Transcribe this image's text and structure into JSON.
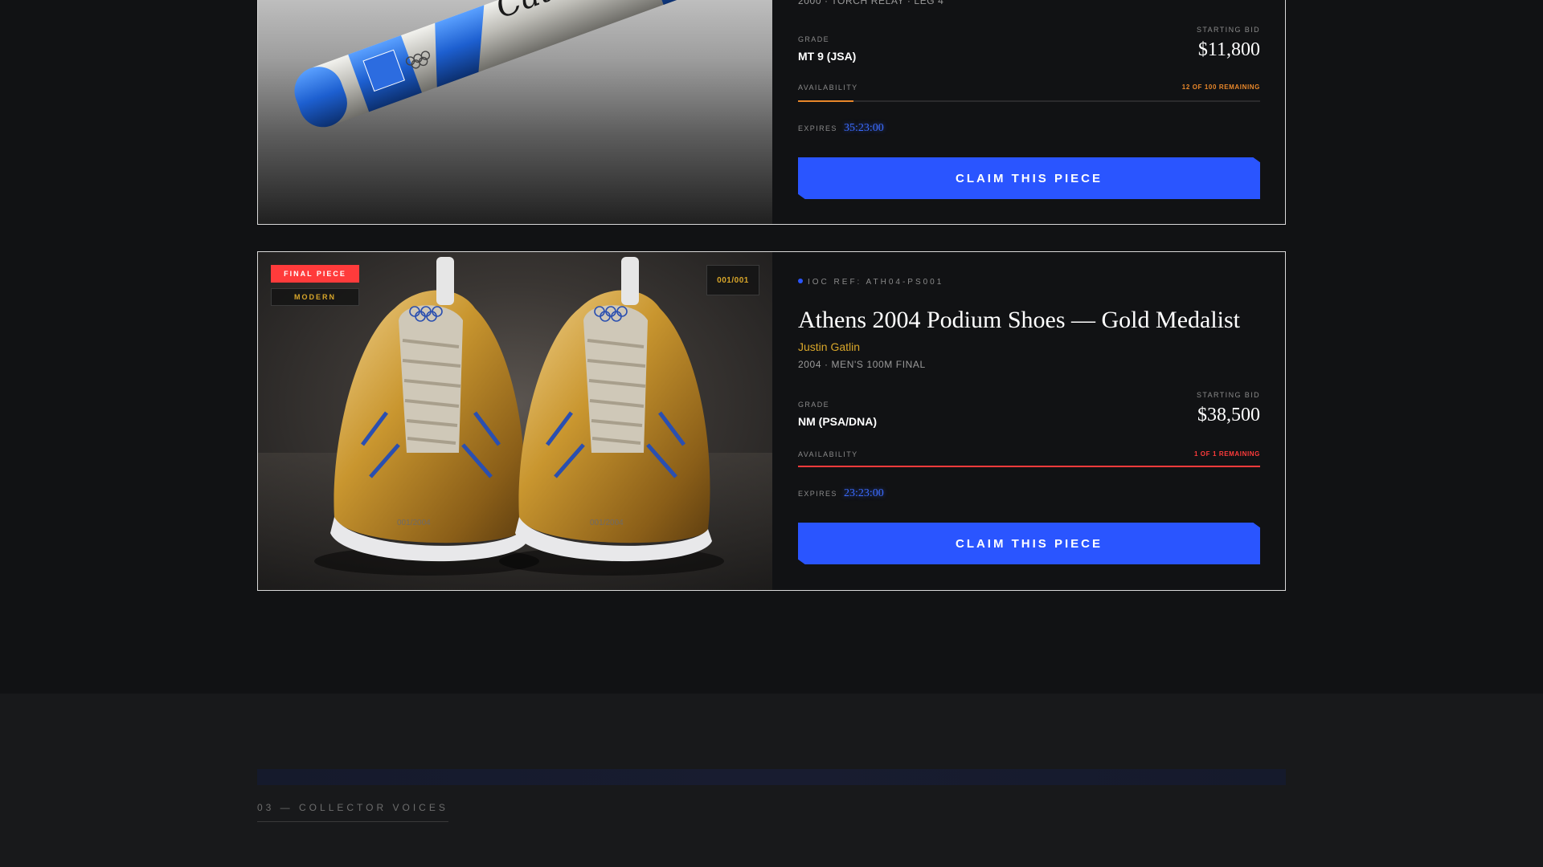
{
  "colors": {
    "accent": "#2a55ff",
    "gold": "#d8a62a",
    "warning_orange": "#e8872a",
    "danger_red": "#ff3b3b",
    "background": "#111214"
  },
  "listings": [
    {
      "subline_partial": "2000 · TORCH RELAY · LEG 4",
      "image_icon": "relay-baton-image",
      "image_signature": "Cathy Freeman",
      "grade_label": "GRADE",
      "grade_value": "MT 9 (JSA)",
      "bid_label": "STARTING BID",
      "bid_value": "$11,800",
      "availability_label": "AVAILABILITY",
      "remaining_text": "12 OF 100 REMAINING",
      "remaining_fraction": 0.12,
      "remaining_color": "#e8872a",
      "expires_label": "EXPIRES",
      "expires_value": "35:23:00",
      "claim_label": "CLAIM THIS PIECE"
    },
    {
      "badges": [
        "FINAL PIECE",
        "MODERN"
      ],
      "edition": "001/001",
      "ioc_ref": "IOC REF: ATH04-PS001",
      "title": "Athens 2004 Podium Shoes — Gold Medalist",
      "athlete": "Justin Gatlin",
      "subline": "2004 · MEN'S 100M FINAL",
      "image_icon": "gold-running-shoes-image",
      "shoe_serial": "001/2004",
      "grade_label": "GRADE",
      "grade_value": "NM (PSA/DNA)",
      "bid_label": "STARTING BID",
      "bid_value": "$38,500",
      "availability_label": "AVAILABILITY",
      "remaining_text": "1 OF 1 REMAINING",
      "remaining_fraction": 1.0,
      "remaining_color": "#ff3b3b",
      "expires_label": "EXPIRES",
      "expires_value": "23:23:00",
      "claim_label": "CLAIM THIS PIECE"
    }
  ],
  "next_section": {
    "label": "03 — COLLECTOR VOICES"
  }
}
